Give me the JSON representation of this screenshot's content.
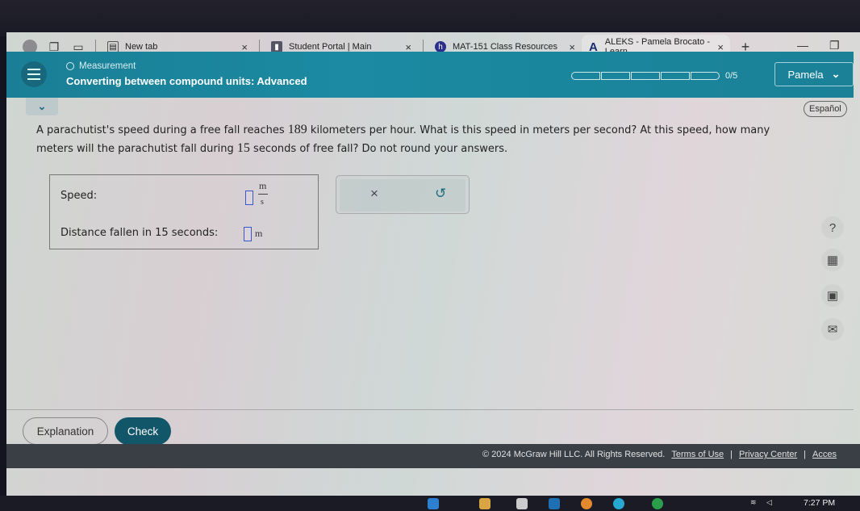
{
  "browser": {
    "tabs": [
      {
        "title": "New tab",
        "icon": "new-tab-icon"
      },
      {
        "title": "Student Portal | Main",
        "icon": "portal-icon"
      },
      {
        "title": "MAT-151 Class Resources",
        "icon": "h-logo-icon"
      },
      {
        "title": "ALEKS - Pamela Brocato - Learn",
        "icon": "aleks-logo-icon",
        "active": true
      }
    ],
    "url": "https://www-awu.aleks.com/alekscgi/x/Isl.exe/1o_u-IgNslkr7j8P3jH-lis_5JdZFdonGg9pInQUm9kiGJhghYuAiZL...",
    "new_tab_symbol": "+",
    "close_symbol": "×"
  },
  "header": {
    "topic": "Measurement",
    "lesson_title": "Converting between compound units: Advanced",
    "progress_label": "0/5",
    "progress_completed": 0,
    "progress_total": 5,
    "user_name": "Pamela"
  },
  "language_button": "Español",
  "question": {
    "part1": "A parachutist's speed during a free fall reaches ",
    "speed_value": "189",
    "part2": " kilometers per hour. What is this speed in meters per second? At this speed, how many meters will the parachutist fall during ",
    "time_value": "15",
    "part3": " seconds of free fall? Do not round your answers."
  },
  "answers": {
    "speed_label": "Speed:",
    "speed_value": "",
    "speed_unit_num": "m",
    "speed_unit_den": "s",
    "distance_label": "Distance fallen in 15 seconds:",
    "distance_value": "",
    "distance_unit": "m"
  },
  "actions": {
    "clear_symbol": "×",
    "undo_symbol": "↺"
  },
  "side_tools": [
    "help-icon",
    "calculator-icon",
    "ebook-icon",
    "mail-icon"
  ],
  "buttons": {
    "explanation": "Explanation",
    "check": "Check"
  },
  "footer": {
    "copyright": "© 2024 McGraw Hill LLC. All Rights Reserved.",
    "terms": "Terms of Use",
    "privacy": "Privacy Center",
    "accessibility": "Acces",
    "separator": "|"
  },
  "taskbar": {
    "time": "7:27 PM"
  }
}
